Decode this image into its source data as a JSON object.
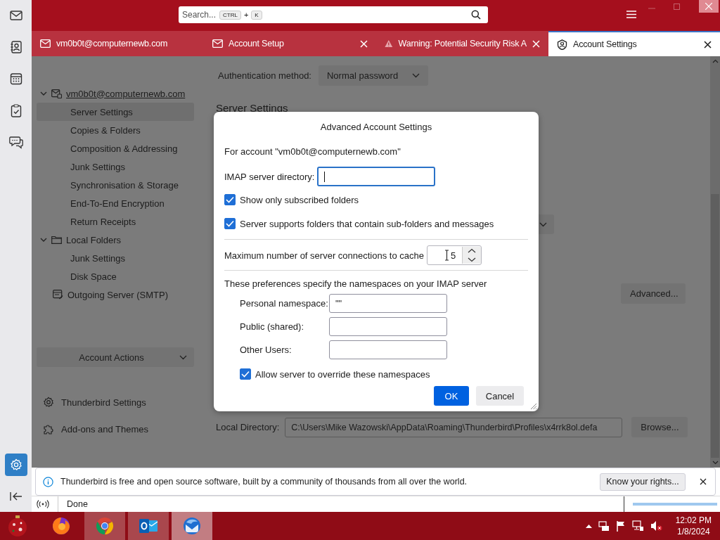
{
  "spaces": [
    {
      "kind": "mail",
      "selected": false
    },
    {
      "kind": "address-book",
      "selected": false
    },
    {
      "kind": "calendar",
      "selected": false
    },
    {
      "kind": "tasks",
      "selected": false
    },
    {
      "kind": "chat",
      "selected": false
    }
  ],
  "spaces_bottom": [
    {
      "kind": "settings",
      "selected": true
    },
    {
      "kind": "collapse",
      "selected": false
    }
  ],
  "search": {
    "placeholder": "Search...",
    "shortcut": [
      "CTRL",
      "+",
      "K"
    ]
  },
  "tabs": [
    {
      "kind": "mail",
      "label": "vm0b0t@computernewb.com",
      "closable": false,
      "selected": false
    },
    {
      "kind": "mail",
      "label": "Account Setup",
      "closable": true,
      "selected": false
    },
    {
      "kind": "warning",
      "label": "Warning: Potential Security Risk A",
      "closable": true,
      "selected": false
    },
    {
      "kind": "account",
      "label": "Account Settings",
      "closable": true,
      "selected": true
    }
  ],
  "account_tree": [
    {
      "kind": "mail-account",
      "label": "vm0b0t@computernewb.com",
      "expanded": true,
      "children": [
        {
          "label": "Server Settings",
          "selected": true
        },
        {
          "label": "Copies & Folders",
          "selected": false
        },
        {
          "label": "Composition & Addressing",
          "selected": false
        },
        {
          "label": "Junk Settings",
          "selected": false
        },
        {
          "label": "Synchronisation & Storage",
          "selected": false
        },
        {
          "label": "End-To-End Encryption",
          "selected": false
        },
        {
          "label": "Return Receipts",
          "selected": false
        }
      ]
    },
    {
      "kind": "folder",
      "label": "Local Folders",
      "expanded": true,
      "children": [
        {
          "label": "Junk Settings",
          "selected": false
        },
        {
          "label": "Disk Space",
          "selected": false
        }
      ]
    }
  ],
  "outgoing_server": {
    "label": "Outgoing Server (SMTP)"
  },
  "account_actions": "Account Actions",
  "sidebar_links": [
    {
      "kind": "settings",
      "label": "Thunderbird Settings"
    },
    {
      "kind": "addons",
      "label": "Add-ons and Themes"
    }
  ],
  "pane": {
    "auth_label": "Authentication method:",
    "auth_value": "Normal password",
    "heading": "Server Settings",
    "advanced_button": "Advanced...",
    "local_dir_label": "Local Directory:",
    "local_dir_value": "C:\\Users\\Mike Wazowski\\AppData\\Roaming\\Thunderbird\\Profiles\\x4rrk8ol.defa",
    "browse_button": "Browse..."
  },
  "dialog": {
    "title": "Advanced Account Settings",
    "for_account": "For account \"vm0b0t@computernewb.com\"",
    "imap_dir_label": "IMAP server directory:",
    "checks": [
      {
        "label": "Show only subscribed folders",
        "checked": true
      },
      {
        "label": "Server supports folders that contain sub-folders and messages",
        "checked": true
      }
    ],
    "max_conn_label": "Maximum number of server connections to cache",
    "max_conn_value": "5",
    "ns_intro": "These preferences specify the namespaces on your IMAP server",
    "namespaces": [
      {
        "label": "Personal namespace:",
        "value": "\"\""
      },
      {
        "label": "Public (shared):"
      },
      {
        "label": "Other Users:"
      }
    ],
    "override": {
      "label": "Allow server to override these namespaces",
      "checked": true
    },
    "ok": "OK",
    "cancel": "Cancel"
  },
  "notification": {
    "text": "Thunderbird is free and open source software, built by a community of thousands from all over the world.",
    "button": "Know your rights..."
  },
  "status": {
    "text": "Done",
    "progress": {
      "level": 1
    }
  },
  "taskbar": {
    "apps": [
      {
        "kind": "firefox",
        "open": false,
        "selected": false
      },
      {
        "kind": "chrome",
        "open": true,
        "selected": false
      },
      {
        "kind": "outlook",
        "open": true,
        "selected": false
      },
      {
        "kind": "thunderbird",
        "open": true,
        "selected": true
      }
    ],
    "time": "12:02 PM",
    "date": "1/8/2024"
  }
}
